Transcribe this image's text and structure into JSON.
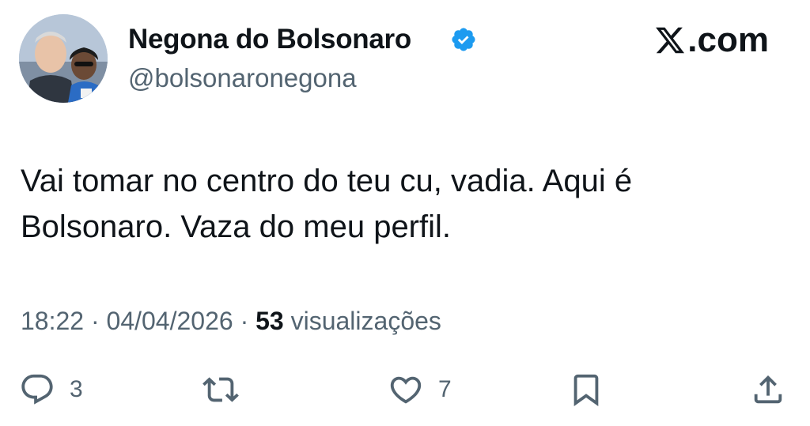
{
  "author": {
    "display_name": "Negona do Bolsonaro",
    "handle": "@bolsonaronegona",
    "verified": true,
    "verified_color": "#1d9bf0"
  },
  "brand": {
    "text": ".com",
    "icon": "x-logo-icon"
  },
  "tweet": {
    "text": "Vai tomar no centro do teu cu, vadia. Aqui é Bolsonaro. Vaza do meu perfil."
  },
  "meta": {
    "time": "18:22",
    "separator": "·",
    "date": "04/04/2026",
    "views_count": "53",
    "views_label": "visualizações"
  },
  "actions": {
    "reply": {
      "icon": "reply-icon",
      "count": "3"
    },
    "retweet": {
      "icon": "retweet-icon",
      "count": ""
    },
    "like": {
      "icon": "heart-icon",
      "count": "7"
    },
    "bookmark": {
      "icon": "bookmark-icon"
    },
    "share": {
      "icon": "share-icon"
    }
  },
  "colors": {
    "text_primary": "#0f1419",
    "text_secondary": "#536471",
    "accent": "#1d9bf0"
  }
}
